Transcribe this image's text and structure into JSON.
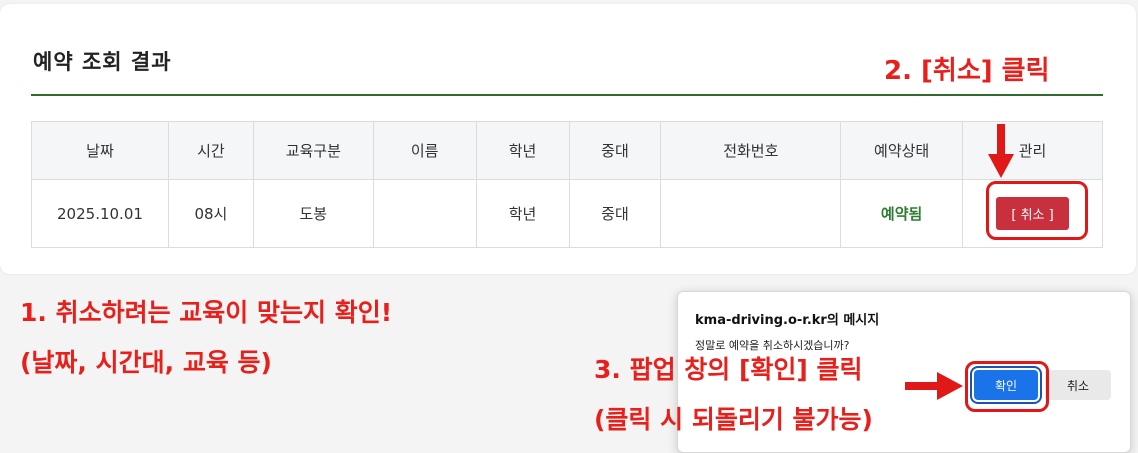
{
  "card": {
    "title": "예약 조회 결과"
  },
  "table": {
    "headers": [
      "날짜",
      "시간",
      "교육구분",
      "이름",
      "학년",
      "중대",
      "전화번호",
      "예약상태",
      "관리"
    ],
    "row": {
      "date": "2025.10.01",
      "time": "08시",
      "course": "도봉",
      "name": "",
      "grade": "학년",
      "company": "중대",
      "phone": "",
      "status": "예약됨",
      "action_label": "[ 취소 ]"
    }
  },
  "annotations": {
    "step1_line1": "1. 취소하려는 교육이 맞는지 확인!",
    "step1_line2": "(날짜, 시간대, 교육 등)",
    "step2": "2. [취소] 클릭",
    "step3_line1": "3. 팝업 창의 [확인] 클릭",
    "step3_line2": "(클릭 시 되돌리기 불가능)"
  },
  "dialog": {
    "title": "kma-driving.o-r.kr의 메시지",
    "message": "정말로 예약을 취소하시겠습니까?",
    "ok_label": "확인",
    "cancel_label": "취소"
  },
  "colors": {
    "annotation_red": "#e8201c",
    "status_green": "#2e7d32",
    "cancel_button": "#c9303e",
    "title_rule": "#2e6b2e",
    "dialog_ok": "#1a73e8"
  }
}
